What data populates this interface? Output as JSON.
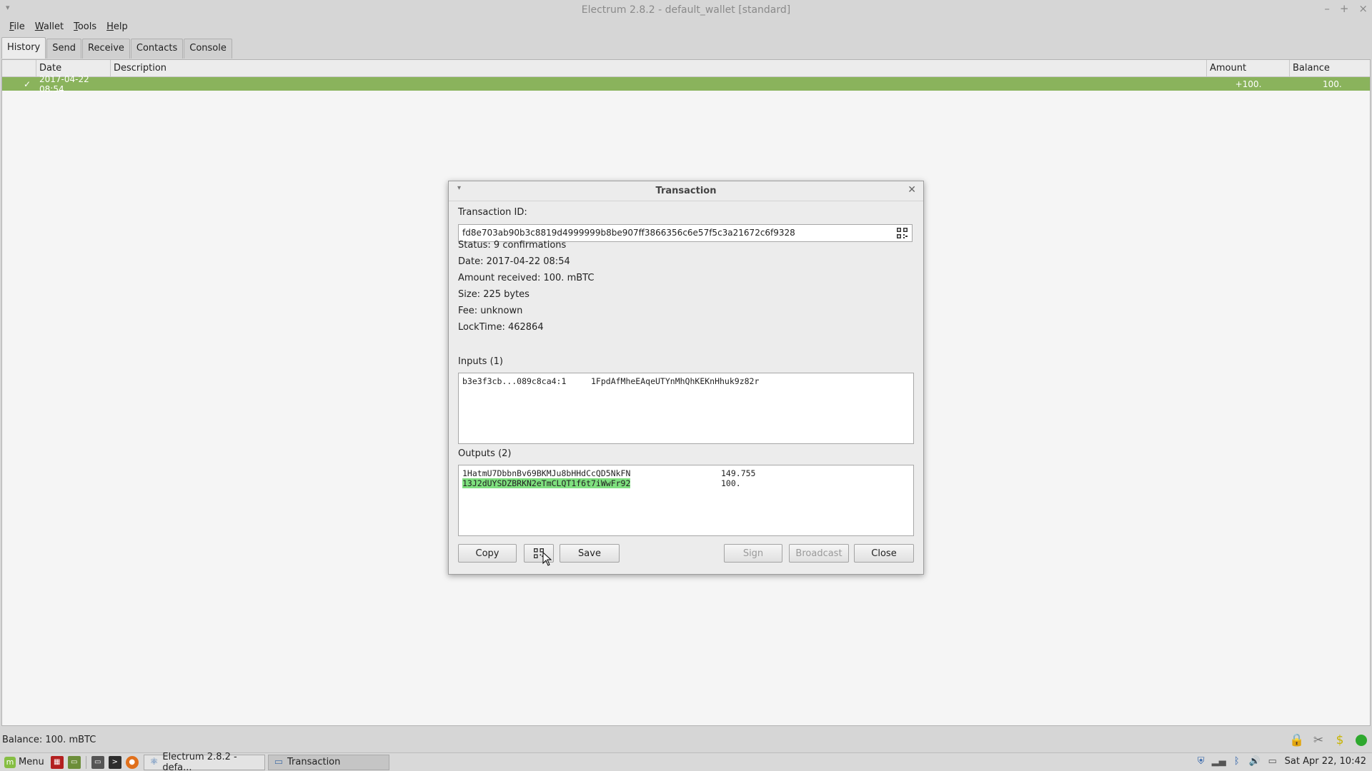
{
  "window": {
    "title": "Electrum 2.8.2 - default_wallet [standard]"
  },
  "menu": [
    "File",
    "Wallet",
    "Tools",
    "Help"
  ],
  "tabs": [
    "History",
    "Send",
    "Receive",
    "Contacts",
    "Console"
  ],
  "history": {
    "columns": [
      "",
      "Date",
      "Description",
      "Amount",
      "Balance"
    ],
    "rows": [
      {
        "date": "2017-04-22 08:54",
        "description": "",
        "amount": "+100.",
        "balance": "100."
      }
    ]
  },
  "status": {
    "balance": "Balance: 100. mBTC"
  },
  "dialog": {
    "title": "Transaction",
    "txid_label": "Transaction ID:",
    "txid": "fd8e703ab90b3c8819d4999999b8be907ff3866356c6e57f5c3a21672c6f9328",
    "status": "Status: 9 confirmations",
    "date": "Date: 2017-04-22 08:54",
    "amount": "Amount received: 100. mBTC",
    "size": "Size: 225 bytes",
    "fee": "Fee: unknown",
    "locktime": "LockTime: 462864",
    "inputs_label": "Inputs (1)",
    "inputs": [
      {
        "prevout": "b3e3f3cb...089c8ca4:1",
        "address": "1FpdAfMheEAqeUTYnMhQhKEKnHhuk9z82r"
      }
    ],
    "outputs_label": "Outputs (2)",
    "outputs": [
      {
        "address": "1HatmU7DbbnBv69BKMJu8bHHdCcQD5NkFN",
        "amount": "149.755",
        "mine": false
      },
      {
        "address": "13J2dUYSDZBRKN2eTmCLQT1f6t7iWwFr92",
        "amount": "100.",
        "mine": true
      }
    ],
    "buttons": {
      "copy": "Copy",
      "save": "Save",
      "sign": "Sign",
      "broadcast": "Broadcast",
      "close": "Close"
    }
  },
  "taskbar": {
    "menu": "Menu",
    "tasks": [
      "Electrum 2.8.2 - defa...",
      "Transaction"
    ],
    "clock": "Sat Apr 22, 10:42"
  },
  "colors": {
    "row_highlight": "#8ab35c",
    "my_address": "#7fe07f"
  }
}
